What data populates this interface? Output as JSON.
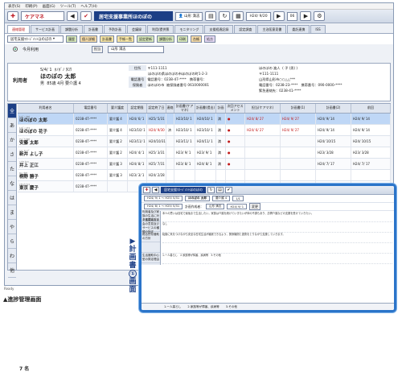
{
  "menubar": [
    "表示(S)",
    "印刷(P)",
    "画面(G)",
    "ツール(T)",
    "ヘルプ(H)"
  ],
  "toolbar": {
    "app_name": "ケアマネ",
    "office": "居宅支援事業所ほのぼの",
    "staff": "山形 満志",
    "date": "H24/ 9/20",
    "date2": "06"
  },
  "tabs": [
    "連絡管理",
    "サービス計画",
    "課題分析",
    "計画書",
    "予防計画",
    "会議録",
    "利用/提供票",
    "モニタリング",
    "支援経過記録",
    "認定調査",
    "主治医意見書",
    "委託連携",
    "ISS"
  ],
  "toprow": {
    "office_select": "居宅支援ﾏﾈｰｼﾞﾒﾝﾄほのぼの",
    "buttons": [
      "履歴",
      "個人詳細",
      "計画書",
      "手帳一覧",
      "認定更新",
      "課題分析",
      "印刷",
      "台帳",
      "処方"
    ],
    "staff_label": "担当",
    "staff_value": "山形 満志"
  },
  "month": {
    "label": "今月利用"
  },
  "user": {
    "label": "利用者",
    "furigana": "ﾎﾉﾎﾞﾉ ﾀﾛｳ",
    "dob": "S/4/ 1",
    "name": "ほのぼの 太郎",
    "gender": "男",
    "age": "85歳 4月",
    "care": "要介護 4",
    "zip": "〒111-1111",
    "address": "ほのぼの県ほのぼの市ほのぼの町1-2-3",
    "addr_label": "住所",
    "phone_label": "電話番号",
    "phone": "電話番号：0238-47-****　携帯番号：",
    "insurer_label": "保険者",
    "insurer": "ほのぼの市",
    "insured_no": "被保険者番号 0610000001",
    "family_label": "連絡先",
    "family_name": "ほのぼの 進人",
    "family_rel": "( 子 (男) )",
    "family_zip": "〒111-1111",
    "family_addr": "山形県山形市○○△△***",
    "family_phone": "電話番号：0238-23-****　携帯番号：090-0000-****",
    "family_fax": "緊急連絡先：0238-41-****",
    "icon": "住所"
  },
  "grid": {
    "kana": [
      "全",
      "あ",
      "か",
      "さ",
      "た",
      "な",
      "は",
      "ま",
      "や",
      "ら",
      "わ",
      "他"
    ],
    "headers": [
      "利用者名",
      "電話番号",
      "要介護度",
      "認定期限",
      "認定終了日",
      "連絡",
      "説明",
      "開始月",
      "計画書(ケアマネ)",
      "計画書(提出)",
      "計画",
      "次回",
      "次回",
      "担当(ケアマネ)",
      "次回アセスメント",
      "計画書(1)",
      "計画書(2)",
      "前回"
    ],
    "rows": [
      {
        "furi": "ﾎﾉﾎﾞﾉ ﾀﾛｳ",
        "name": "ほのぼの 太郎",
        "tel": "0238-47-****",
        "care": "要介護 4",
        "d1": "H24/ 6/ 1",
        "d2": "H25/ 5/31",
        "m": "",
        "d3": "H23/10/ 1",
        "d4": "H24/10/ 1",
        "f": "満",
        "mark": "●",
        "d5": "H24/ 8/ 27",
        "d6": "H24/ 9/ 27",
        "d7": "H24/ 9/ 14",
        "d8": "H24/ 9/ 14",
        "d9": "H24/ 9/ 14",
        "sel": true
      },
      {
        "furi": "ﾎﾉﾎﾞﾉ ﾊﾅｺ",
        "name": "ほのぼの 花子",
        "tel": "0238-47-****",
        "care": "要介護 4",
        "d1": "H23/10/ 1",
        "d2": "H24/ 9/30",
        "m": "済",
        "d3": "H23/10/ 1",
        "d4": "H23/10/ 1",
        "f": "満",
        "mark": "●",
        "d5": "H24/ 6/ 27",
        "d6": "H24/ 9/ 27",
        "d7": "H24/ 9/ 14",
        "d8": "H24/ 9/ 14",
        "d9": "H24/ 9/ 14",
        "sel": false
      },
      {
        "furi": "ｱﾝﾄﾞｳ ﾀﾛｳ",
        "name": "安藤 太郎",
        "tel": "0238-47-****",
        "care": "要介護 2",
        "d1": "H23/11/ 1",
        "d2": "H24/10/31",
        "m": "",
        "d3": "H23/11/ 1",
        "d4": "H24/11/ 1",
        "f": "満",
        "mark": "●",
        "d5": "",
        "d6": "",
        "d7": "H24/ 10/15",
        "d8": "H24/ 10/15",
        "d9": "H24/ 10/15",
        "sel": false
      },
      {
        "furi": "ｼﾝｲ ﾖｼﾉﾌﾞ",
        "name": "新井 よし子",
        "tel": "0238-47-****",
        "care": "要介護 2",
        "d1": "H24/ 4/ 1",
        "d2": "H25/ 3/31",
        "m": "",
        "d3": "H23/ 9/ 1",
        "d4": "H23/ 9/ 1",
        "f": "満",
        "mark": "●",
        "d5": "",
        "d6": "",
        "d7": "H23/ 3/28",
        "d8": "H23/ 3/28",
        "d9": "H23/ 3/28",
        "sel": false
      },
      {
        "furi": "ｲﾉｳｴ ｾｲｺ",
        "name": "井上 正江",
        "tel": "0238-47-****",
        "care": "要介護 3",
        "d1": "H24/ 8/ 1",
        "d2": "H25/ 7/31",
        "m": "",
        "d3": "H23/ 8/ 1",
        "d4": "H24/ 8/ 1",
        "f": "満",
        "mark": "●",
        "d5": "",
        "d6": "",
        "d7": "H24/ 7/ 17",
        "d8": "H24/ 7/ 17",
        "d9": "H24/ 7/ 17",
        "sel": false
      },
      {
        "furi": "ｷﾘﾉ ﾀﾛｳ",
        "name": "桐野 勝子",
        "tel": "0238-47-****",
        "care": "要介護 3",
        "d1": "H23/ 3/ 1",
        "d2": "H24/ 2/28",
        "m": "",
        "d3": "",
        "d4": "",
        "f": "",
        "mark": "",
        "d5": "",
        "d6": "",
        "d7": "",
        "d8": "",
        "d9": "",
        "sel": false
      },
      {
        "furi": "ﾄｳｷｮｳ ｹｲｺ",
        "name": "東京 慶子",
        "tel": "0238-47-****",
        "care": "",
        "d1": "",
        "d2": "",
        "m": "",
        "d3": "",
        "d4": "",
        "f": "",
        "mark": "",
        "d5": "",
        "d6": "",
        "d7": "",
        "d8": "",
        "d9": "",
        "sel": false
      }
    ],
    "count": "7 名"
  },
  "status": "Ready",
  "caption": "▲進捗管理画面",
  "vertical_label": [
    "▶",
    "計",
    "画",
    "書",
    "①",
    "画",
    "面"
  ],
  "inset": {
    "office": "居宅支援ﾏﾈｰｼﾞﾒﾝﾄほのぼの",
    "row1": [
      "H24/ 9/ 1 ～ H25/ 5/31",
      "ほのぼの 太郎",
      "要介護 4",
      "1/1"
    ],
    "row2": [
      "H24/ 8/ 1 ～ H25/ 5/31",
      "計画作成者：",
      "山形 満志",
      "H24/ 9/ 1",
      "変更"
    ],
    "labels": [
      "利用者及び家族の生活に対する意向",
      "介護認定審査会の意見及びサービスの種類の指定",
      "総合的な援助の方針",
      "",
      "生活援助中心型の算定理由"
    ],
    "texts": [
      "本人の思いは自宅で最後まで生活したい。家族は介護を続けていきたいが体の不調もあり、訪問介護などの支援を受けていきたい。",
      "なし",
      "転倒に気をつけながら安全な在宅生活が継続できるよう、関係機関と連携をとりながら支援していきます。",
      "",
      "1.一人暮らし　2.家族等が障害、疾病等　3.その他"
    ],
    "footer": [
      "1.一人暮らし",
      "2.家族等が障害、疾病等",
      "3.その他"
    ]
  }
}
